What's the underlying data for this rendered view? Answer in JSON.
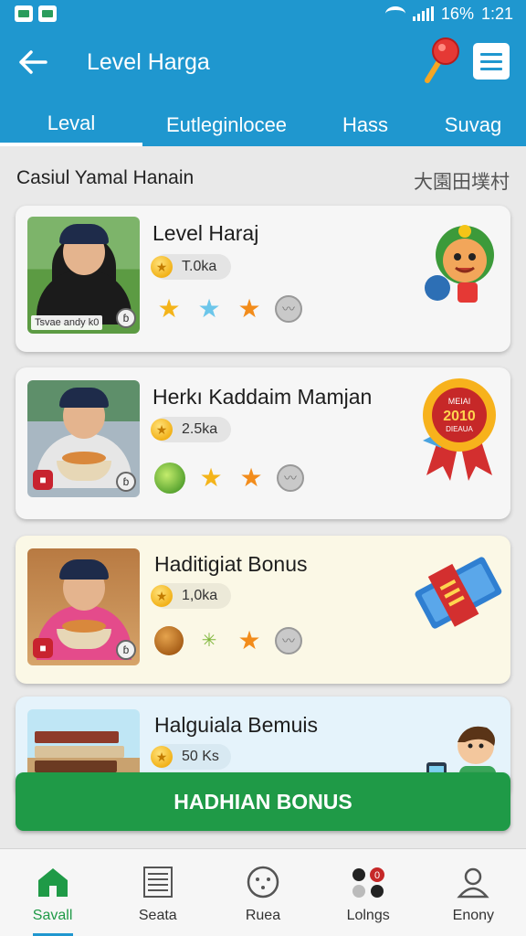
{
  "status_bar": {
    "battery": "16%",
    "time": "1:21"
  },
  "header": {
    "title": "Level Harga",
    "back_icon": "arrow-left-icon",
    "tabs": [
      {
        "label": "Leval",
        "active": true
      },
      {
        "label": "Eutleginlocee",
        "active": false
      },
      {
        "label": "Hass",
        "active": false
      },
      {
        "label": "Suvag",
        "active": false
      }
    ]
  },
  "section": {
    "title": "Casiul Yamal Hanain",
    "right_label": "大園田墣村"
  },
  "cards": [
    {
      "title": "Level Haraj",
      "amount": "T.0ka",
      "photo_caption": "Tsvae andy k0",
      "badge_glyph": "ɓ",
      "icons": [
        "star-gold-icon",
        "star-blue-icon",
        "star-orange-icon",
        "grey-coin-icon"
      ],
      "decoration": "mascot-icon"
    },
    {
      "title": "Herkı Kaddaim Mamjan",
      "amount": "2.5ka",
      "badge_glyph": "ɓ",
      "icons": [
        "lime-icon",
        "star-gold-icon",
        "star-orange-icon",
        "grey-coin-icon"
      ],
      "decoration": "award-ribbon-icon",
      "ribbon_text": {
        "top": "MEIAI",
        "year": "2010",
        "bottom": "DIEAUA"
      }
    },
    {
      "title": "Haditigiat Bonus",
      "amount": "1,0ka",
      "badge_glyph": "ɓ",
      "icons": [
        "nut-icon",
        "sparkle-icon",
        "star-orange-icon",
        "grey-coin-icon"
      ],
      "decoration": "ticket-icon"
    },
    {
      "title": "Halguiala Bemuis",
      "amount": "50 Ks",
      "decoration": "kid-phone-icon"
    }
  ],
  "cta": {
    "label": "HADHIAN BONUS"
  },
  "bottom_nav": [
    {
      "label": "Savall",
      "icon": "home-icon",
      "active": true
    },
    {
      "label": "Seata",
      "icon": "list-icon",
      "active": false
    },
    {
      "label": "Ruea",
      "icon": "face-icon",
      "active": false
    },
    {
      "label": "Lolngs",
      "icon": "dots-icon",
      "active": false,
      "badge": "0"
    },
    {
      "label": "Enony",
      "icon": "person-icon",
      "active": false
    }
  ],
  "colors": {
    "primary": "#1f97cf",
    "cta": "#1f9a47",
    "background": "#e9e9e9"
  }
}
